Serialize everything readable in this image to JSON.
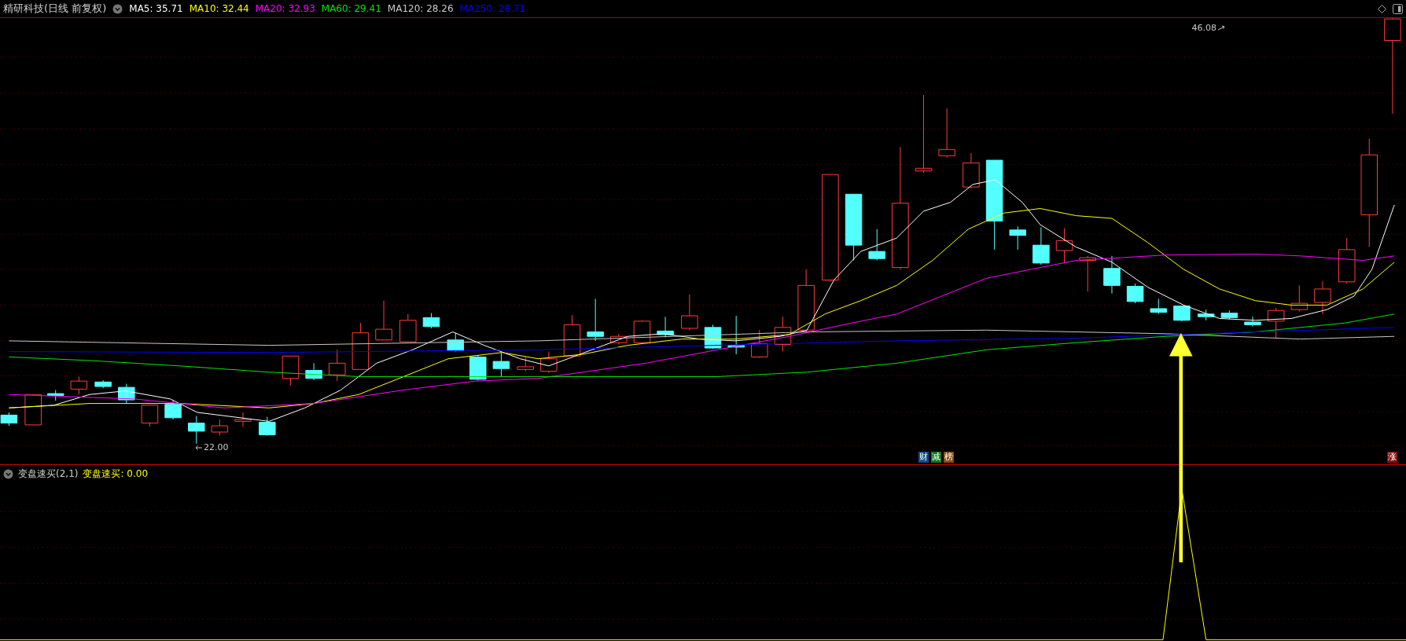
{
  "header": {
    "title": "精研科技(日线 前复权)",
    "averages": [
      {
        "label": "MA5: 35.71",
        "color": "#ffffff"
      },
      {
        "label": "MA10: 32.44",
        "color": "#ffff00"
      },
      {
        "label": "MA20: 32.93",
        "color": "#ff00ff"
      },
      {
        "label": "MA60: 29.41",
        "color": "#00e600"
      },
      {
        "label": "MA120: 28.26",
        "color": "#c8c8c8"
      },
      {
        "label": "MA250: 28.71",
        "color": "#0000ff"
      }
    ]
  },
  "price_labels": [
    {
      "kind": "high",
      "text": "46.08"
    },
    {
      "kind": "low",
      "text": "22.00"
    }
  ],
  "badges": [
    {
      "text": "财",
      "color": "#0b4c8c"
    },
    {
      "text": "减",
      "color": "#0b7a1e"
    },
    {
      "text": "榜",
      "color": "#8c4a0b"
    },
    {
      "text": "涨",
      "color": "#8c0b0b"
    }
  ],
  "indicator": {
    "title": "变盘速买(2,1)",
    "value": "变盘速买: 0.00"
  }
}
